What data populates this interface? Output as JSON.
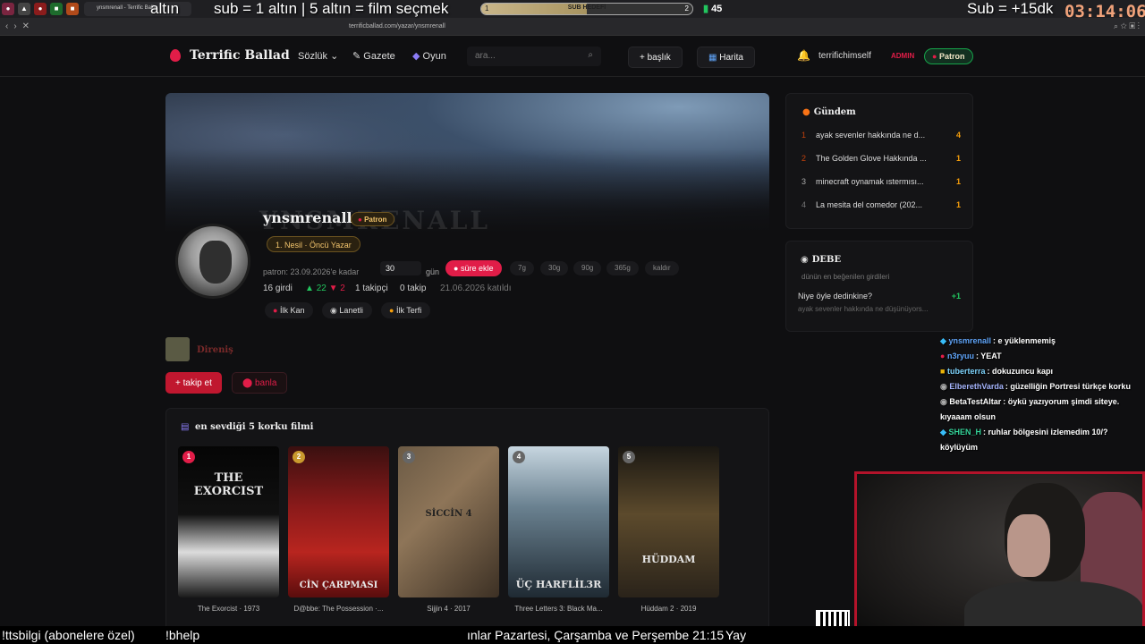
{
  "stream_overlay": {
    "top_left_text": "altın",
    "top_mid_text": "sub = 1 altın | 5 altın = film seçmek",
    "goal": {
      "label": "SUB HEDEFİ",
      "start": "1",
      "end": "2",
      "progress": 0.5
    },
    "gem_count": "45",
    "top_right_text": "Sub = +15dk",
    "timer": "03:14:06",
    "ticker": [
      "!ttsbilgi (abonelere özel)",
      "!bhelp",
      "ınlar Pazartesi, Çarşamba ve Perşembe 21:15",
      "Yay"
    ]
  },
  "browser": {
    "active_tab_title": "ynsmrenall - Terrific Balla",
    "url": "terrificballad.com/yazar/ynsmrenall"
  },
  "header": {
    "logo": "Terrific Ballad",
    "nav": [
      "Sözlük",
      "Gazete",
      "Oyun"
    ],
    "search_placeholder": "ara...",
    "new_topic": "+ başlık",
    "map": "Harita",
    "username": "terrifichimself",
    "admin_badge": "ADMIN",
    "patron_badge": "Patron"
  },
  "profile": {
    "banner_ghost": "YNSMRENALL",
    "username": "ynsmrenall",
    "patron_badge": "Patron",
    "rank": "1. Nesil · Öncü Yazar",
    "patron_until": "patron: 23.09.2026'e kadar",
    "days_value": "30",
    "days_unit": "gün",
    "add_time": "süre ekle",
    "presets": [
      "7g",
      "30g",
      "90g",
      "365g",
      "kaldır"
    ],
    "entries": "16 girdi",
    "upvotes": "22",
    "downvotes": "2",
    "followers": "1 takipçi",
    "following": "0 takip",
    "joined": "21.06.2026 katıldı",
    "badges": [
      "İlk Kan",
      "Lanetli",
      "İlk Terfi"
    ],
    "guild": "Direniş",
    "follow_btn": "+ takip et",
    "ban_btn": "banla"
  },
  "movies": {
    "title": "en sevdiği 5 korku filmi",
    "items": [
      {
        "rank": "1",
        "art": "THE EXORCIST",
        "caption": "The Exorcist · 1973"
      },
      {
        "rank": "2",
        "art": "CİN ÇARPMASI",
        "caption": "D@bbe: The Possession ·..."
      },
      {
        "rank": "3",
        "art": "SİCCİN 4",
        "caption": "Sijjin 4 · 2017"
      },
      {
        "rank": "4",
        "art": "ÜÇ HARFLİL3R",
        "caption": "Three Letters 3: Black Ma..."
      },
      {
        "rank": "5",
        "art": "HÜDDAM",
        "caption": "Hüddam 2 · 2019"
      }
    ]
  },
  "gundem": {
    "title": "Gündem",
    "items": [
      {
        "idx": "1",
        "text": "ayak sevenler hakkında ne d...",
        "count": "4"
      },
      {
        "idx": "2",
        "text": "The Golden Glove Hakkında ...",
        "count": "1"
      },
      {
        "idx": "3",
        "text": "minecraft oynamak ıstermısı...",
        "count": "1"
      },
      {
        "idx": "4",
        "text": "La mesita del comedor (202...",
        "count": "1"
      }
    ]
  },
  "debe": {
    "title": "DEBE",
    "subtitle": "dünün en beğenilen girdileri",
    "entry_title": "Niye öyle dedinkine?",
    "entry_score": "+1",
    "entry_topic": "ayak sevenler hakkında ne düşünüyors..."
  },
  "chat": [
    {
      "user": "ynsmrenall",
      "color": "#60a5fa",
      "msg": ": e yüklenmemiş"
    },
    {
      "user": "n3ryuu",
      "color": "#60a5fa",
      "msg": ": YEAT"
    },
    {
      "user": "tuberterra",
      "color": "#7dd3fc",
      "msg": ": dokuzuncu kapı"
    },
    {
      "user": "ElberethVarda",
      "color": "#a5b4fc",
      "msg": ": güzelliğin Portresi türkçe korku"
    },
    {
      "user": "BetaTestAltar",
      "color": "#ffffff",
      "msg": ": öykü yazıyorum şimdi siteye. kıyaaam olsun"
    },
    {
      "user": "SHEN_H",
      "color": "#34d399",
      "msg": ": ruhlar bölgesini izlemedim 10/? köylüyüm"
    }
  ],
  "colors": {
    "accent": "#e11d48",
    "gold": "#f2c46c",
    "green": "#22c55e"
  }
}
